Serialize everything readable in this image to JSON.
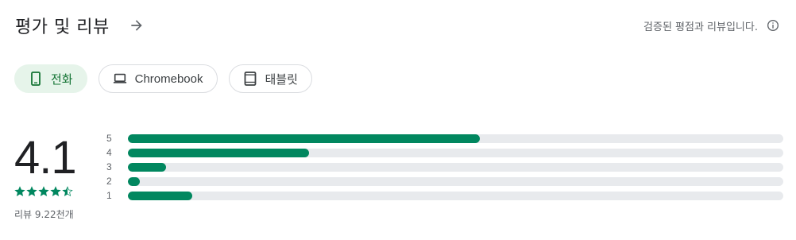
{
  "header": {
    "title": "평가 및 리뷰",
    "verified_text": "검증된 평점과 리뷰입니다."
  },
  "device_chips": [
    {
      "label": "전화",
      "icon": "phone-icon",
      "active": true
    },
    {
      "label": "Chromebook",
      "icon": "laptop-icon",
      "active": false
    },
    {
      "label": "태블릿",
      "icon": "tablet-icon",
      "active": false
    }
  ],
  "summary": {
    "score": "4.1",
    "stars": 4.5,
    "review_count": "리뷰 9.22천개"
  },
  "rating_bars": [
    {
      "label": "5",
      "fraction": 0.537
    },
    {
      "label": "4",
      "fraction": 0.276
    },
    {
      "label": "3",
      "fraction": 0.058
    },
    {
      "label": "2",
      "fraction": 0.018
    },
    {
      "label": "1",
      "fraction": 0.098
    }
  ],
  "colors": {
    "accent": "#01875f",
    "chip_active_bg": "#e6f4ea",
    "chip_active_text": "#137333",
    "track": "#e8eaed"
  }
}
